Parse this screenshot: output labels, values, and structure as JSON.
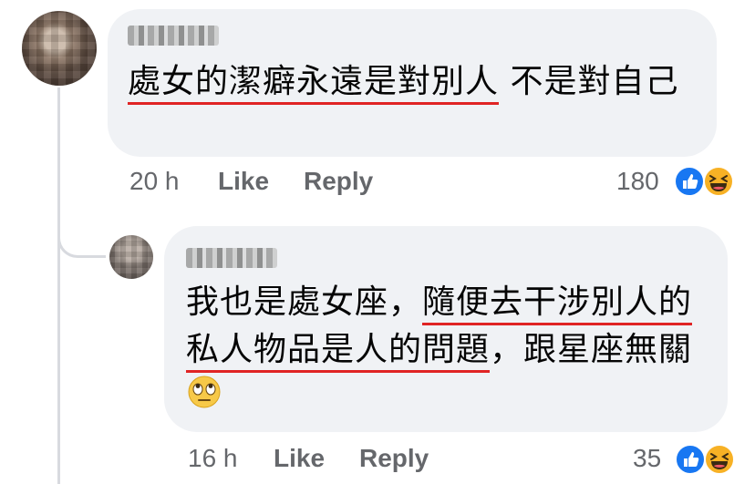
{
  "comment": {
    "author_name": "",
    "text_underlined": "處女的潔癖永遠是對別人",
    "text_rest": " 不是對自己",
    "time": "20 h",
    "like_label": "Like",
    "reply_label": "Reply",
    "reaction_count": "180",
    "reactions": [
      "like-icon",
      "haha-icon"
    ]
  },
  "reply": {
    "author_name": "",
    "text_part1": "我也是處女座，",
    "text_underlined": "隨便去干涉別人的私人物品是人的問題",
    "text_part2": "，跟星座無關",
    "emoji": "eye-roll-emoji",
    "time": "16 h",
    "like_label": "Like",
    "reply_label": "Reply",
    "reaction_count": "35",
    "reactions": [
      "like-icon",
      "haha-icon"
    ]
  },
  "colors": {
    "bubble": "#f0f2f5",
    "meta_text": "#65676b",
    "underline": "#e02424",
    "like_blue": "#1877f2",
    "haha_yellow": "#f7b125"
  }
}
